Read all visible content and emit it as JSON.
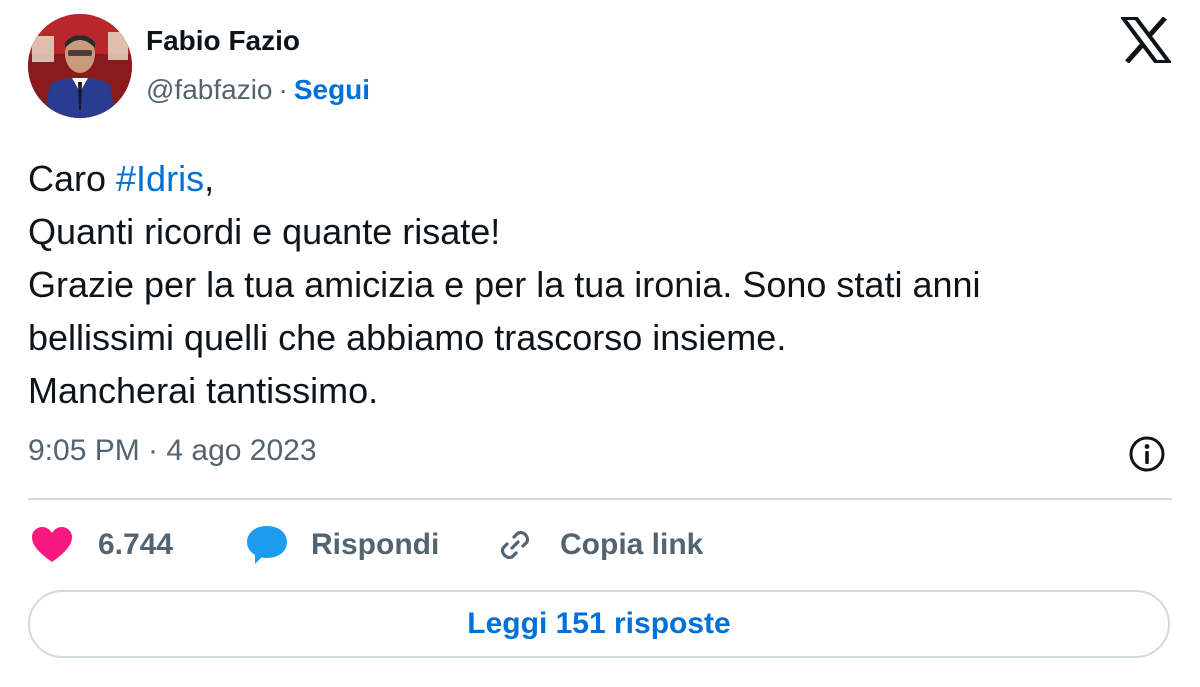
{
  "author": {
    "name": "Fabio Fazio",
    "handle": "@fabfazio",
    "separator": "·",
    "follow_label": "Segui"
  },
  "tweet": {
    "lines": [
      {
        "prefix": "Caro ",
        "hashtag": "#Idris",
        "suffix": ","
      },
      {
        "text": "Quanti ricordi e quante risate!"
      },
      {
        "text": "Grazie per la tua amicizia e per la tua ironia. Sono stati anni"
      },
      {
        "text": "bellissimi quelli che abbiamo trascorso insieme."
      },
      {
        "text": "Mancherai tantissimo."
      }
    ],
    "timestamp": "9:05 PM · 4 ago 2023"
  },
  "actions": {
    "like_count": "6.744",
    "reply_label": "Rispondi",
    "copy_label": "Copia link"
  },
  "read_replies_label": "Leggi 151 risposte",
  "icons": {
    "logo": "x-logo-icon",
    "info": "info-icon",
    "like": "heart-icon",
    "reply": "speech-bubble-icon",
    "copy": "link-icon"
  },
  "colors": {
    "link": "#006fd6",
    "heart": "#f91880",
    "reply_bubble": "#1d9bf0",
    "secondary_text": "#536471",
    "divider": "#cfd9de"
  }
}
